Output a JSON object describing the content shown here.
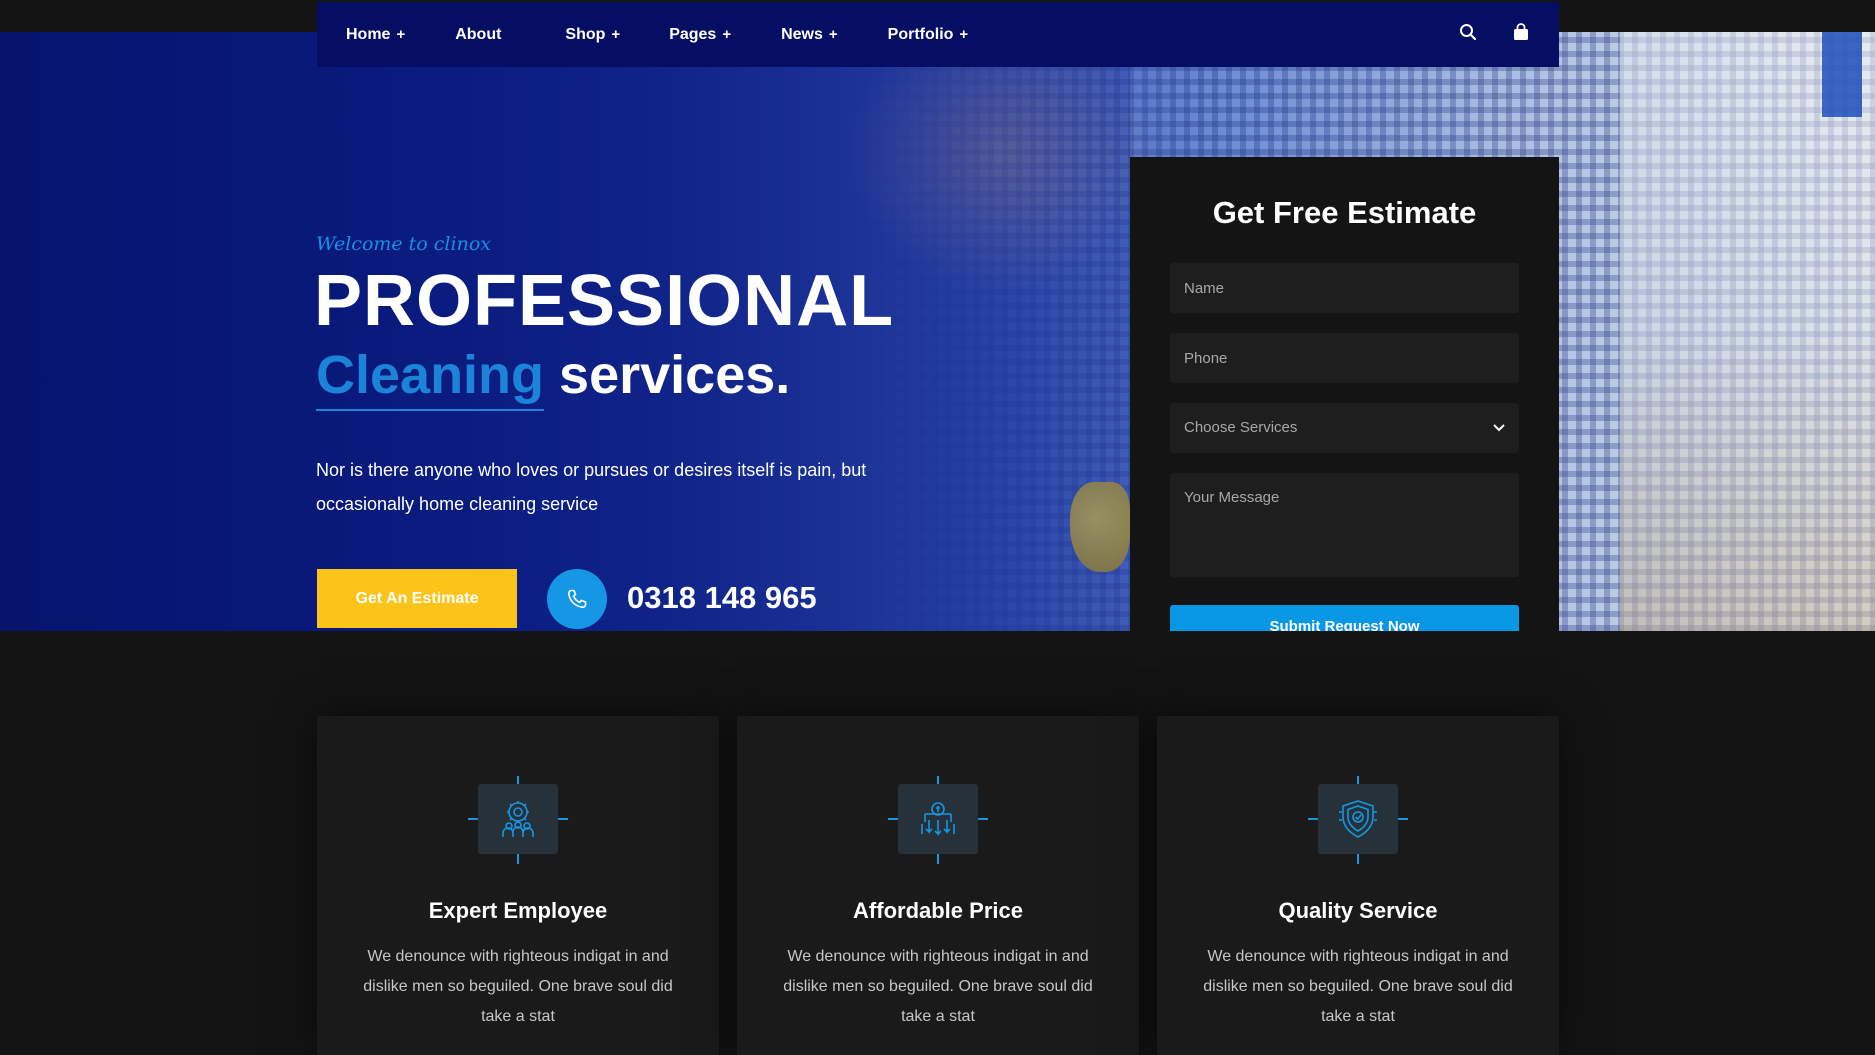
{
  "nav": {
    "items": [
      {
        "label": "Home",
        "has_sub": true
      },
      {
        "label": "About",
        "has_sub": false
      },
      {
        "label": "Shop",
        "has_sub": true
      },
      {
        "label": "Pages",
        "has_sub": true
      },
      {
        "label": "News",
        "has_sub": true
      },
      {
        "label": "Portfolio",
        "has_sub": true
      }
    ],
    "plus": "+",
    "icons": [
      "search-icon",
      "shopping-bag-icon"
    ]
  },
  "hero": {
    "welcome": "Welcome to clinox",
    "title_line1": "PROFESSIONAL",
    "title_highlight": "Cleaning",
    "title_rest": "services.",
    "description": "Nor is there anyone who loves or pursues or desires itself is pain, but occasionally home cleaning service",
    "cta_label": "Get An Estimate",
    "phone": "0318 148 965"
  },
  "form": {
    "title": "Get Free Estimate",
    "name_placeholder": "Name",
    "phone_placeholder": "Phone",
    "service_placeholder": "Choose Services",
    "message_placeholder": "Your Message",
    "submit_label": "Submit Request Now"
  },
  "features": [
    {
      "title": "Expert Employee",
      "text": "We denounce with righteous indigat in and dislike men so beguiled. One brave soul did take a stat",
      "icon": "team-gear-icon"
    },
    {
      "title": "Affordable Price",
      "text": "We denounce with righteous indigat in and dislike men so beguiled. One brave soul did take a stat",
      "icon": "price-hand-icon"
    },
    {
      "title": "Quality Service",
      "text": "We denounce with righteous indigat in and dislike men so beguiled. One brave soul did take a stat",
      "icon": "shield-badge-icon"
    }
  ],
  "colors": {
    "nav_bg": "#050e63",
    "accent_blue": "#1597e5",
    "cta_yellow": "#fcc419",
    "page_bg": "#141414",
    "card_bg": "#1a1a1a"
  }
}
